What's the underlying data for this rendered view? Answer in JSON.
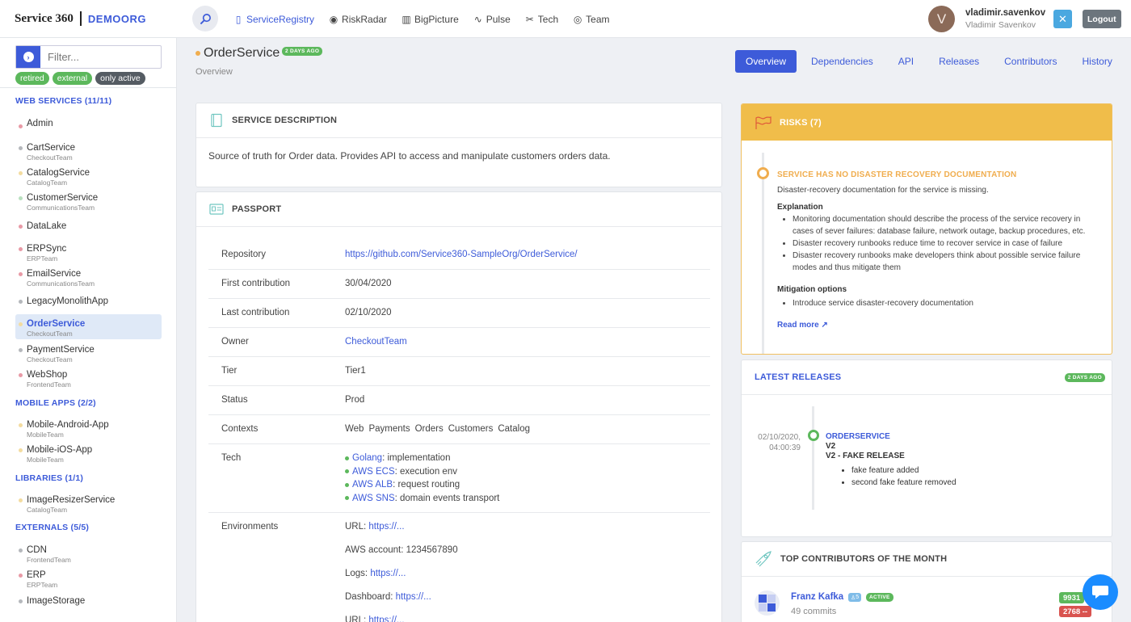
{
  "brand": {
    "logo": "Service 360",
    "org": "DEMOORG"
  },
  "topnav": [
    {
      "label": "ServiceRegistry",
      "icon": "clipboard-icon",
      "active": true
    },
    {
      "label": "RiskRadar",
      "icon": "eye-icon",
      "active": false
    },
    {
      "label": "BigPicture",
      "icon": "map-icon",
      "active": false
    },
    {
      "label": "Pulse",
      "icon": "pulse-icon",
      "active": false
    },
    {
      "label": "Tech",
      "icon": "tools-icon",
      "active": false
    },
    {
      "label": "Team",
      "icon": "team-icon",
      "active": false
    }
  ],
  "user": {
    "initial": "V",
    "login": "vladimir.savenkov",
    "name": "Vladimir Savenkov",
    "logout": "Logout"
  },
  "sidebar": {
    "filter_placeholder": "Filter...",
    "tags": [
      "retired",
      "external",
      "only active"
    ],
    "sections": [
      {
        "title": "WEB SERVICES (11/11)"
      },
      {
        "title": "MOBILE APPS (2/2)"
      },
      {
        "title": "LIBRARIES (1/1)"
      },
      {
        "title": "EXTERNALS (5/5)"
      }
    ],
    "services": [
      {
        "name": "Admin",
        "team": ""
      },
      {
        "name": "CartService",
        "team": "CheckoutTeam"
      },
      {
        "name": "CatalogService",
        "team": "CatalogTeam"
      },
      {
        "name": "CustomerService",
        "team": "CommunicationsTeam"
      },
      {
        "name": "DataLake",
        "team": ""
      },
      {
        "name": "ERPSync",
        "team": "ERPTeam"
      },
      {
        "name": "EmailService",
        "team": "CommunicationsTeam"
      },
      {
        "name": "LegacyMonolithApp",
        "team": ""
      },
      {
        "name": "OrderService",
        "team": "CheckoutTeam"
      },
      {
        "name": "PaymentService",
        "team": "CheckoutTeam"
      },
      {
        "name": "WebShop",
        "team": "FrontendTeam"
      },
      {
        "name": "Mobile-Android-App",
        "team": "MobileTeam"
      },
      {
        "name": "Mobile-iOS-App",
        "team": "MobileTeam"
      },
      {
        "name": "ImageResizerService",
        "team": "CatalogTeam"
      },
      {
        "name": "CDN",
        "team": "FrontendTeam"
      },
      {
        "name": "ERP",
        "team": "ERPTeam"
      },
      {
        "name": "ImageStorage",
        "team": ""
      }
    ]
  },
  "page": {
    "title": "OrderService",
    "badge": "2 DAYS AGO",
    "subtitle": "Overview",
    "tabs": [
      "Overview",
      "Dependencies",
      "API",
      "Releases",
      "Contributors",
      "History"
    ]
  },
  "description": {
    "heading": "SERVICE DESCRIPTION",
    "text": "Source of truth for Order data. Provides API to access and manipulate customers orders data."
  },
  "passport": {
    "heading": "PASSPORT",
    "rows": {
      "repository": {
        "key": "Repository",
        "value": "https://github.com/Service360-SampleOrg/OrderService/"
      },
      "first": {
        "key": "First contribution",
        "value": "30/04/2020"
      },
      "last": {
        "key": "Last contribution",
        "value": "02/10/2020"
      },
      "owner": {
        "key": "Owner",
        "value": "CheckoutTeam"
      },
      "tier": {
        "key": "Tier",
        "value": "Tier1"
      },
      "status": {
        "key": "Status",
        "value": "Prod"
      },
      "contexts": {
        "key": "Contexts",
        "values": [
          "Web",
          "Payments",
          "Orders",
          "Customers",
          "Catalog"
        ]
      },
      "tech": {
        "key": "Tech",
        "items": [
          {
            "name": "Golang",
            "purpose": ": implementation"
          },
          {
            "name": "AWS ECS",
            "purpose": ": execution env"
          },
          {
            "name": "AWS ALB",
            "purpose": ": request routing"
          },
          {
            "name": "AWS SNS",
            "purpose": ": domain events transport"
          }
        ]
      },
      "environments": {
        "key": "Environments",
        "url_label": "URL: ",
        "url": "https://...",
        "aws_account": "AWS account: 1234567890",
        "logs_label": "Logs: ",
        "logs": "https://...",
        "dashboard_label": "Dashboard: ",
        "dashboard": "https://...",
        "url2_label": "URL: ",
        "url2": "https://..."
      }
    }
  },
  "risks": {
    "heading": "RISKS (7)",
    "title": "SERVICE HAS NO DISASTER RECOVERY DOCUMENTATION",
    "summary": "Disaster-recovery documentation for the service is missing.",
    "explanation_label": "Explanation",
    "explanation": [
      "Monitoring documentation should describe the process of the service recovery in cases of sever failures: database failure, network outage, backup procedures, etc.",
      "Disaster recovery runbooks reduce time to recover service in case of failure",
      "Disaster recovery runbooks make developers think about possible service failure modes and thus mitigate them"
    ],
    "mitigation_label": "Mitigation options",
    "mitigation": [
      "Introduce service disaster-recovery documentation"
    ],
    "read_more": "Read more"
  },
  "releases": {
    "heading": "LATEST RELEASES",
    "badge": "2 DAYS AGO",
    "date": "02/10/2020,",
    "time": "04:00:39",
    "service": "ORDERSERVICE",
    "version": "V2",
    "name": "V2 - FAKE RELEASE",
    "notes": [
      "fake feature added",
      "second fake feature removed"
    ]
  },
  "contributors": {
    "heading": "TOP CONTRIBUTORS OF THE MONTH",
    "name": "Franz Kafka",
    "rank": "5",
    "status": "ACTIVE",
    "commits": "49 commits",
    "added": "9931",
    "removed": "2768 --"
  },
  "colors": {
    "accent": "#3d5bd9",
    "risk": "#f0bd4a",
    "green": "#5cb85c",
    "red": "#d9534f",
    "dot_red": "#e89aa6",
    "dot_gray": "#b5b8bc",
    "dot_yellow": "#f3dca0",
    "dot_green": "#b9e0bf"
  }
}
